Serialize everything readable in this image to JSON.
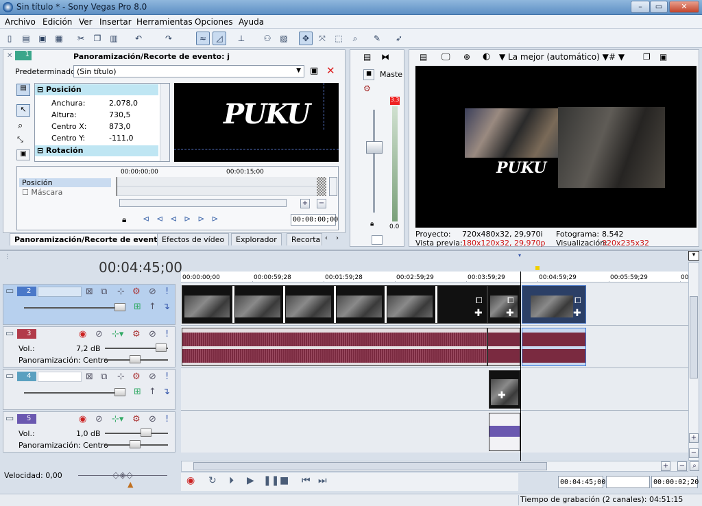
{
  "window": {
    "title": "Sin título * - Sony Vegas Pro 8.0",
    "min": "–",
    "max": "▭",
    "close": "✕"
  },
  "menu": [
    "Archivo",
    "Edición",
    "Ver",
    "Insertar",
    "Herramientas",
    "Opciones",
    "Ayuda"
  ],
  "pan": {
    "track_no": "1",
    "title": "Panoramización/Recorte de evento: j",
    "preset_label": "Predeterminado:",
    "preset_value": "(Sin título)",
    "sections": {
      "position": "Posición",
      "rotation": "Rotación"
    },
    "props": [
      {
        "k": "Anchura:",
        "v": "2.078,0"
      },
      {
        "k": "Altura:",
        "v": "730,5"
      },
      {
        "k": "Centro X:",
        "v": "873,0"
      },
      {
        "k": "Centro Y:",
        "v": "-111,0"
      }
    ],
    "kf_time0": "00:00:00;00",
    "kf_time1": "00:00:15;00",
    "kf_rows": [
      "Posición",
      "Máscara"
    ],
    "cursor": "00:00:00;00",
    "logo": "PUKU"
  },
  "tabs": [
    "Panoramización/Recorte de event",
    "Efectos de vídeo",
    "Explorador",
    "Recorta"
  ],
  "master": {
    "label": "Maste",
    "peak": "3.3",
    "zero": "0.0"
  },
  "preview": {
    "quality": "La mejor (automático)",
    "project_label": "Proyecto:",
    "project_value": "720x480x32, 29,970i",
    "preview_label": "Vista previa:",
    "preview_value": "180x120x32, 29,970p",
    "frame_label": "Fotograma:",
    "frame_value": "8.542",
    "display_label": "Visualización:",
    "display_value": "320x235x32"
  },
  "timeline": {
    "current": "00:04:45;00",
    "ruler": [
      "00:00:00;00",
      "00:00:59;28",
      "00:01:59;28",
      "00:02:59;29",
      "00:03:59;29",
      "00:04:59;29",
      "00:05:59;29",
      "00:"
    ],
    "tracks": [
      {
        "num": "2",
        "type": "video",
        "color": "#4a78c8"
      },
      {
        "num": "3",
        "type": "audio",
        "color": "#b23b4a",
        "vol_label": "Vol.:",
        "vol": "7,2 dB",
        "pan_label": "Panoramización:",
        "pan": "Centro"
      },
      {
        "num": "4",
        "type": "video",
        "color": "#5aa0c0"
      },
      {
        "num": "5",
        "type": "audio",
        "color": "#6a58b0",
        "vol_label": "Vol.:",
        "vol": "1,0 dB",
        "pan_label": "Panoramización:",
        "pan": "Centro"
      }
    ]
  },
  "transport": {
    "speed_label": "Velocidad: 0,00",
    "time": "00:04:45;00",
    "dur": "00:00:02;20",
    "status": "Tiempo de grabación (2 canales): 04:51:15"
  },
  "colors": {
    "accent": "#5d8fc4",
    "selected_track": "#b7d0ee",
    "audio_wave": "#7a2a40",
    "purple_wave": "#6a58b0"
  }
}
